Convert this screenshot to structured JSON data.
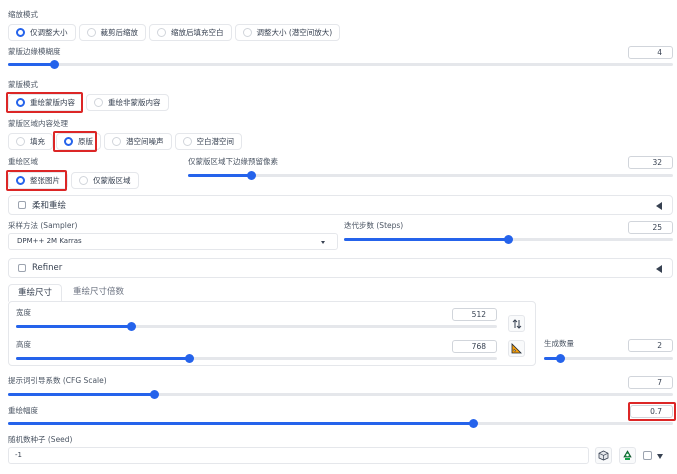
{
  "resize_mode": {
    "label": "缩放模式",
    "options": [
      "仅调整大小",
      "裁剪后缩放",
      "缩放后填充空白",
      "调整大小 (潜空间放大)"
    ],
    "selected": 0
  },
  "mask_blur": {
    "label": "蒙版边缘模糊度",
    "value": "4",
    "fraction": 0.07
  },
  "mask_mode": {
    "label": "蒙版模式",
    "options": [
      "重绘蒙版内容",
      "重绘非蒙版内容"
    ],
    "selected": 0
  },
  "masked_content": {
    "label": "蒙版区域内容处理",
    "options": [
      "填充",
      "原版",
      "潜空间噪声",
      "空白潜空间"
    ],
    "selected": 1
  },
  "inpaint_area": {
    "label": "重绘区域",
    "options": [
      "整张图片",
      "仅蒙版区域"
    ],
    "selected": 0
  },
  "only_masked_padding": {
    "label": "仅蒙版区域下边缘预留像素",
    "value": "32",
    "fraction": 0.13
  },
  "soft_inpainting": {
    "label": "柔和重绘"
  },
  "sampler": {
    "label": "采样方法 (Sampler)",
    "value": "DPM++ 2M Karras"
  },
  "steps": {
    "label": "迭代步数 (Steps)",
    "value": "25",
    "fraction": 0.5
  },
  "refiner": {
    "label": "Refiner"
  },
  "size_tabs": [
    "重绘尺寸",
    "重绘尺寸倍数"
  ],
  "width": {
    "label": "宽度",
    "value": "512",
    "fraction": 0.24
  },
  "height": {
    "label": "高度",
    "value": "768",
    "fraction": 0.36
  },
  "batch_count": {
    "label": "生成数量",
    "value": "2",
    "fraction": 0.13
  },
  "cfg_scale": {
    "label": "提示词引导系数 (CFG Scale)",
    "value": "7",
    "fraction": 0.22
  },
  "denoising": {
    "label": "重绘幅度",
    "value": "0.7",
    "fraction": 0.7
  },
  "seed": {
    "label": "随机数种子 (Seed)",
    "value": "-1"
  }
}
